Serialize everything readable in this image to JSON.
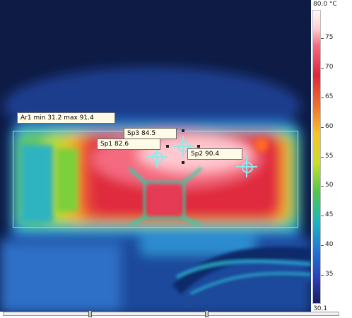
{
  "colorbar": {
    "max_label": "80.0 °C",
    "min_label": "30.1",
    "ticks": [
      "75",
      "70",
      "65",
      "60",
      "55",
      "50",
      "45",
      "40",
      "35"
    ]
  },
  "measurements": {
    "area": "Ar1 min 31.2 max 91.4",
    "spot1": "Sp1 82.6",
    "spot2": "Sp2 90.4",
    "spot3": "Sp3 84.5"
  },
  "colors": {
    "background_cold": "#0e1b45",
    "marker": "#8fe8ea",
    "label_bg": "#fffbe6"
  },
  "icons": [
    "crosshair-icon",
    "resize-handle-icon",
    "slider-thumb-icon"
  ]
}
